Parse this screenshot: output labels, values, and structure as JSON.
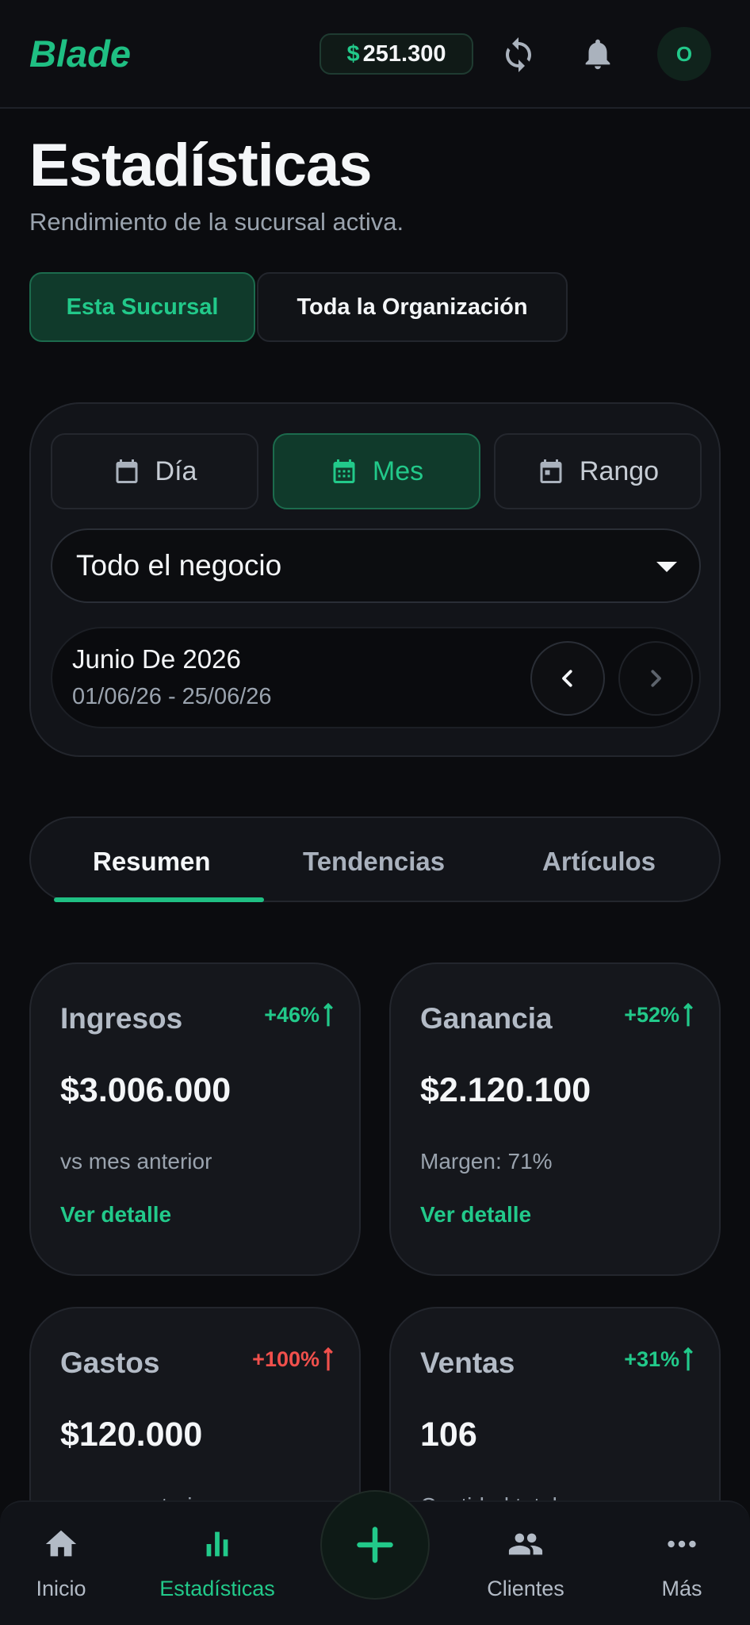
{
  "header": {
    "brand": "Blade",
    "balance_currency": "$",
    "balance_value": "251.300",
    "avatar_initial": "O",
    "icons": [
      "sync-icon",
      "bell-icon"
    ]
  },
  "page": {
    "title": "Estadísticas",
    "subtitle": "Rendimiento de la sucursal activa."
  },
  "scope_tabs": [
    {
      "label": "Esta Sucursal",
      "active": true
    },
    {
      "label": "Toda la Organización",
      "active": false
    }
  ],
  "filters": {
    "periods": [
      {
        "label": "Día",
        "active": false,
        "icon": "calendar-icon"
      },
      {
        "label": "Mes",
        "active": true,
        "icon": "calendar-icon"
      },
      {
        "label": "Rango",
        "active": false,
        "icon": "calendar-icon"
      }
    ],
    "scope_select": "Todo el negocio",
    "date_title": "Junio De 2026",
    "date_range": "01/06/26 - 25/06/26"
  },
  "section_tabs": [
    {
      "label": "Resumen",
      "active": true
    },
    {
      "label": "Tendencias",
      "active": false
    },
    {
      "label": "Artículos",
      "active": false
    }
  ],
  "stats": [
    {
      "label": "Ingresos",
      "change": "+46%",
      "trend": "up",
      "value": "$3.006.000",
      "note": "vs mes anterior",
      "link": "Ver detalle"
    },
    {
      "label": "Ganancia",
      "change": "+52%",
      "trend": "up",
      "value": "$2.120.100",
      "note": "Margen: 71%",
      "link": "Ver detalle"
    },
    {
      "label": "Gastos",
      "change": "+100%",
      "trend": "negative",
      "value": "$120.000",
      "note": "vs mes anterior",
      "link": ""
    },
    {
      "label": "Ventas",
      "change": "+31%",
      "trend": "up",
      "value": "106",
      "note": "Cantidad total",
      "link": ""
    }
  ],
  "bottom_nav": [
    {
      "label": "Inicio",
      "icon": "home-icon",
      "active": false
    },
    {
      "label": "Estadísticas",
      "icon": "bar-chart-icon",
      "active": true
    },
    {
      "label": "Clientes",
      "icon": "people-icon",
      "active": false
    },
    {
      "label": "Más",
      "icon": "more-icon",
      "active": false
    }
  ],
  "colors": {
    "accent": "#22c98a",
    "negative": "#f0504c",
    "background": "#0b0c0f",
    "card": "#15171c"
  }
}
